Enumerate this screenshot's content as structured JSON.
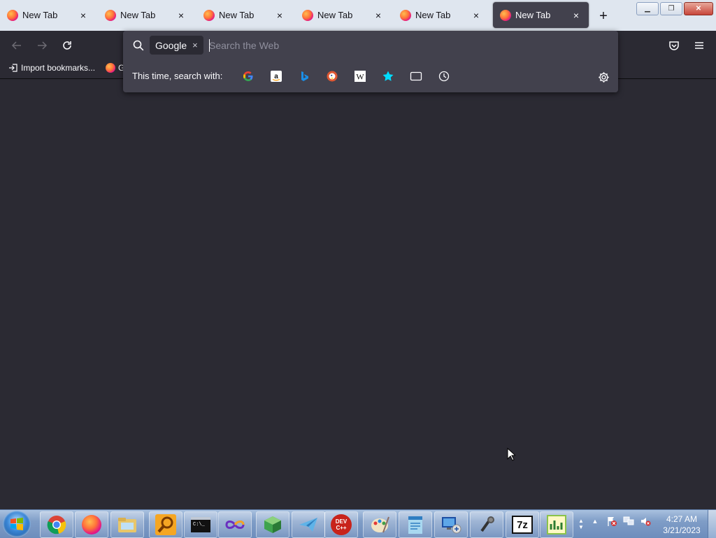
{
  "tabs": [
    {
      "title": "New Tab",
      "active": false
    },
    {
      "title": "New Tab",
      "active": false
    },
    {
      "title": "New Tab",
      "active": false
    },
    {
      "title": "New Tab",
      "active": false
    },
    {
      "title": "New Tab",
      "active": false
    },
    {
      "title": "New Tab",
      "active": true
    }
  ],
  "tab_close": "×",
  "new_tab": "+",
  "window_buttons": {
    "minimize": "▁",
    "restore": "❐",
    "close": "✕"
  },
  "bookmarks": [
    {
      "label": "Import bookmarks...",
      "icon": "import-icon"
    },
    {
      "label": "G",
      "icon": "firefox-icon"
    }
  ],
  "urlbar": {
    "engine_chip": "Google",
    "engine_chip_close": "×",
    "placeholder": "Search the Web",
    "value": ""
  },
  "one_off": {
    "label": "This time, search with:",
    "engines": [
      "google-icon",
      "amazon-icon",
      "bing-icon",
      "duckduckgo-icon",
      "wikipedia-icon",
      "bookmarks-star-icon",
      "tabs-icon",
      "history-icon"
    ]
  },
  "colors": {
    "toolbar": "#2b2a33",
    "popup": "#42414d",
    "tabbar": "#dfe6ef",
    "accent_blue": "#00ddff"
  },
  "taskbar": {
    "apps": [
      "chrome-icon",
      "firefox-icon",
      "file-explorer-icon",
      "search-magnifier-icon",
      "command-prompt-icon",
      "infinity-app-icon",
      "3d-box-app-icon",
      "paper-plane-app-icon",
      "dev-cpp-icon",
      "paint-icon",
      "notepad-icon",
      "remote-desktop-icon",
      "microphone-icon",
      "7zip-icon",
      "chart-app-icon"
    ],
    "devcpp_label": "DEV C++",
    "sevenzip_label": "7z",
    "clock_time": "4:27 AM",
    "clock_date": "3/21/2023"
  }
}
